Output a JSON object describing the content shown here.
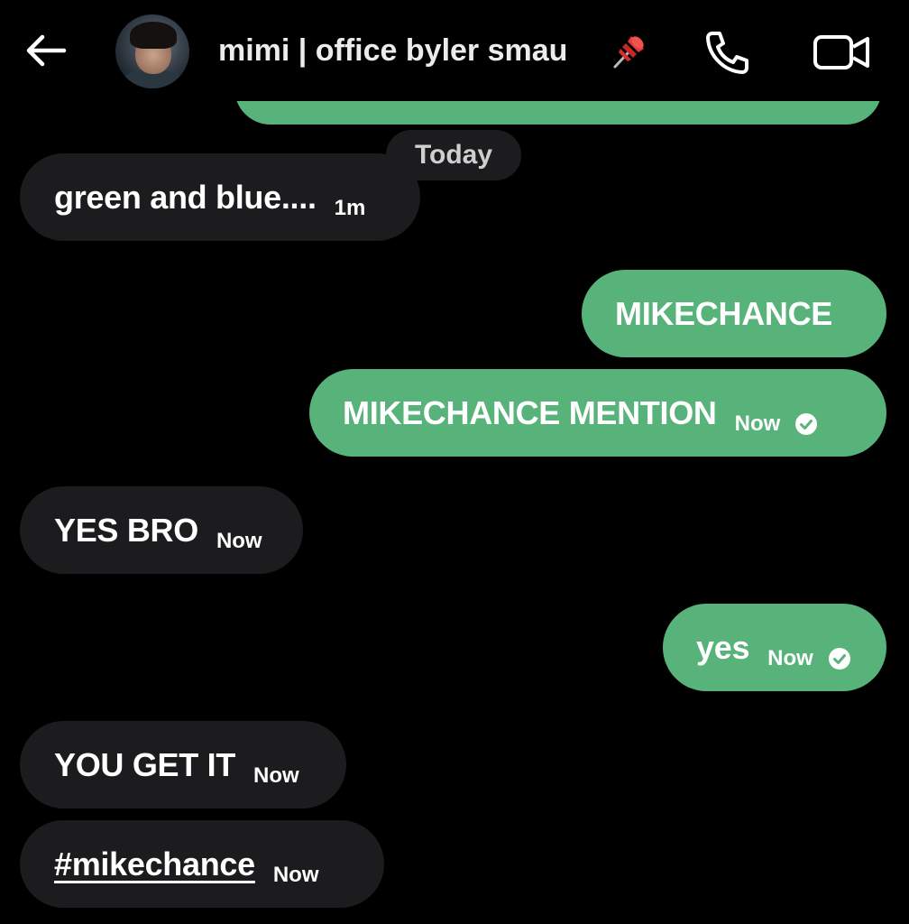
{
  "header": {
    "contact_name": "mimi | office byler smau",
    "icons": {
      "back": "arrow-left-icon",
      "pin": "pushpin-icon",
      "call": "phone-icon",
      "video": "video-camera-icon"
    }
  },
  "divider": {
    "label": "Today"
  },
  "colors": {
    "background": "#000000",
    "incoming_bubble": "#1c1c1e",
    "outgoing_bubble": "#58b37a",
    "text": "#ffffff"
  },
  "messages": [
    {
      "direction": "in",
      "text": "green and blue....",
      "time": "1m"
    },
    {
      "direction": "out",
      "text": "MIKECHANCE",
      "time": ""
    },
    {
      "direction": "out",
      "text": "MIKECHANCE MENTION",
      "time": "Now",
      "status": "read-check-icon"
    },
    {
      "direction": "in",
      "text": "YES BRO",
      "time": "Now"
    },
    {
      "direction": "out",
      "text": "yes",
      "time": "Now",
      "status": "read-check-icon"
    },
    {
      "direction": "in",
      "text": "YOU GET IT",
      "time": "Now"
    },
    {
      "direction": "in",
      "text": "#mikechance",
      "time": "Now"
    }
  ]
}
